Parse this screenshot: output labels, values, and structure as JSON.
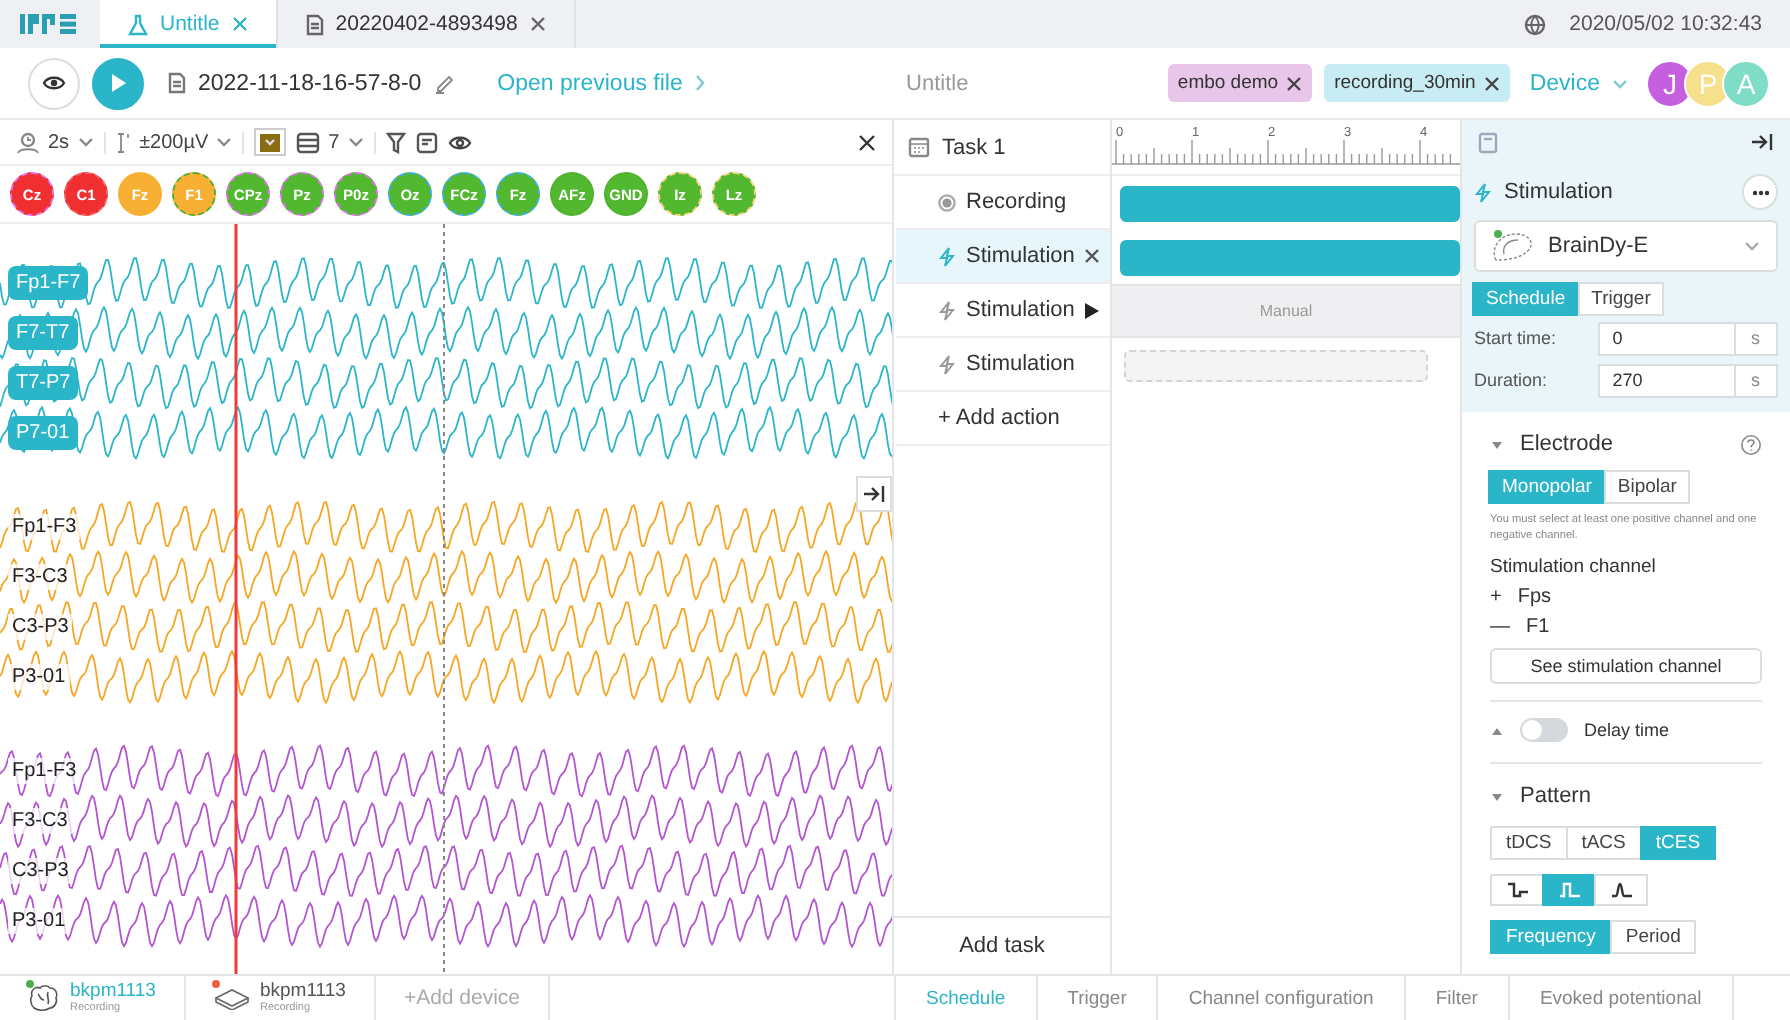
{
  "app_tabs": [
    {
      "label": "Untitle",
      "kind": "flask",
      "selected": true
    },
    {
      "label": "20220402-4893498",
      "kind": "file",
      "selected": false
    }
  ],
  "clock": "2020/05/02 10:32:43",
  "toolbar": {
    "filename": "2022-11-18-16-57-8-0",
    "open_link": "Open previous file",
    "title": "Untitle",
    "tags": [
      {
        "label": "embo demo",
        "color": "#e8c6ea"
      },
      {
        "label": "recording_30min",
        "color": "#c8ecf3"
      }
    ],
    "device_link": "Device",
    "avatars": [
      {
        "initial": "J",
        "color": "#c65ee0"
      },
      {
        "initial": "P",
        "color": "#f6e08c"
      },
      {
        "initial": "A",
        "color": "#7fdcc6"
      }
    ]
  },
  "eeg": {
    "time_scale": "2s",
    "amplitude": "±200µV",
    "color_button": {
      "color": "#8a6d12"
    },
    "rows": "7",
    "channels": [
      {
        "label": "Cz",
        "color": "#f03030",
        "ring": {
          "color": "#e070f0"
        }
      },
      {
        "label": "C1",
        "color": "#f03030",
        "ring": {
          "color": "#f06060"
        }
      },
      {
        "label": "Fz",
        "color": "#f7b034",
        "ring": {
          "color": "#f7b034"
        }
      },
      {
        "label": "F1",
        "color": "#f7b034",
        "ring": {
          "color": "#4caf30"
        }
      },
      {
        "label": "CPz",
        "color": "#52b830",
        "ring": {
          "color": "#e070f0"
        }
      },
      {
        "label": "Pz",
        "color": "#52b830",
        "ring": {
          "color": "#e070f0"
        }
      },
      {
        "label": "P0z",
        "color": "#52b830",
        "ring": {
          "color": "#e070f0"
        }
      },
      {
        "label": "Oz",
        "color": "#52b830",
        "ring": {
          "color": "#3aaef0"
        }
      },
      {
        "label": "FCz",
        "color": "#52b830",
        "ring": {
          "color": "#3aaef0"
        }
      },
      {
        "label": "Fz",
        "color": "#52b830",
        "ring": {
          "color": "#3aaef0"
        }
      },
      {
        "label": "AFz",
        "color": "#52b830",
        "ring": {
          "color": "#4caf30"
        }
      },
      {
        "label": "GND",
        "color": "#52b830",
        "ring": {
          "color": "#4caf30"
        }
      },
      {
        "label": "Iz",
        "color": "#52b830",
        "ring": {
          "color": "#f7d070"
        }
      },
      {
        "label": "Lz",
        "color": "#52b830",
        "ring": {
          "color": "#f7d070"
        }
      }
    ],
    "groups": [
      {
        "color": "#2bb5c8",
        "badge": true,
        "labels": [
          "Fp1-F7",
          "F7-T7",
          "T7-P7",
          "P7-01"
        ]
      },
      {
        "color": "#f5a623",
        "badge": false,
        "labels": [
          "Fp1-F3",
          "F3-C3",
          "C3-P3",
          "P3-01"
        ]
      },
      {
        "color": "#b455d0",
        "badge": false,
        "labels": [
          "Fp1-F3",
          "F3-C3",
          "C3-P3",
          "P3-01"
        ]
      }
    ]
  },
  "tasks": {
    "title": "Task 1",
    "actions": [
      {
        "kind": "recording",
        "label": "Recording",
        "selected": false,
        "playing": false,
        "track": {
          "kind": "bar"
        }
      },
      {
        "kind": "stimulation",
        "label": "Stimulation",
        "selected": true,
        "playing": false,
        "track": {
          "kind": "bar"
        }
      },
      {
        "kind": "stimulation",
        "label": "Stimulation",
        "selected": false,
        "playing": true,
        "track": {
          "kind": "manual",
          "label": "Manual"
        }
      },
      {
        "kind": "stimulation",
        "label": "Stimulation",
        "selected": false,
        "playing": false,
        "track": {
          "kind": "empty"
        }
      }
    ],
    "add_action": "+ Add action",
    "add_task": "Add task"
  },
  "timeline": {
    "ruler_labels": [
      "0",
      "1",
      "2",
      "3",
      "4"
    ]
  },
  "stimulation": {
    "title": "Stimulation",
    "device": "BrainDy-E",
    "modes": [
      {
        "label": "Schedule",
        "selected": true
      },
      {
        "label": "Trigger",
        "selected": false
      }
    ],
    "fields": [
      {
        "label": "Start time:",
        "value": "0",
        "unit": "s"
      },
      {
        "label": "Duration:",
        "value": "270",
        "unit": "s"
      }
    ],
    "electrode": {
      "title": "Electrode",
      "expanded": true,
      "types": [
        {
          "label": "Monopolar",
          "selected": true
        },
        {
          "label": "Bipolar",
          "selected": false
        }
      ],
      "note": "You must select at least one positive channel and one negative channel.",
      "channel_title": "Stimulation channel",
      "channels": [
        {
          "sign": "+",
          "name": "Fps"
        },
        {
          "sign": "—",
          "name": "F1"
        }
      ],
      "button": "See stimulation channel"
    },
    "delay": {
      "label": "Delay time",
      "on": false,
      "expanded": false
    },
    "pattern": {
      "title": "Pattern",
      "expanded": true,
      "types": [
        {
          "label": "tDCS",
          "selected": false
        },
        {
          "label": "tACS",
          "selected": false
        },
        {
          "label": "tCES",
          "selected": true
        }
      ],
      "shapes": [
        {
          "kind": "biphasic",
          "selected": false
        },
        {
          "kind": "pulse",
          "selected": true
        },
        {
          "kind": "spike",
          "selected": false
        }
      ],
      "units": [
        {
          "label": "Frequency",
          "selected": true
        },
        {
          "label": "Period",
          "selected": false
        }
      ]
    }
  },
  "devices": [
    {
      "name": "bkpm1113",
      "status": "Recording",
      "kind": "brain",
      "color": "#4caf50",
      "active": true
    },
    {
      "name": "bkpm1113",
      "status": "Recording",
      "kind": "device",
      "color": "#f06040",
      "active": false
    }
  ],
  "add_device": "+Add device",
  "bottom_tabs": [
    {
      "label": "Schedule",
      "selected": true
    },
    {
      "label": "Trigger",
      "selected": false
    },
    {
      "label": "Channel configuration",
      "selected": false
    },
    {
      "label": "Filter",
      "selected": false
    },
    {
      "label": "Evoked potentional",
      "selected": false
    }
  ]
}
